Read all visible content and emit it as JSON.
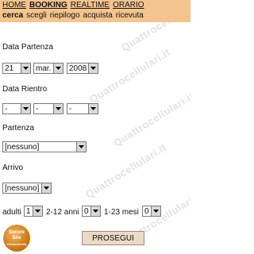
{
  "nav": {
    "links": [
      "HOME",
      "BOOKING",
      "REALTIME",
      "ORARIO"
    ],
    "sublinks": [
      "cerca",
      "scegli",
      "riepilogo",
      "acquista",
      "ricevuta"
    ]
  },
  "form": {
    "data_partenza_label": "Data Partenza",
    "partenza_day": "21",
    "partenza_month": "mar.",
    "partenza_year": "2008",
    "data_rientro_label": "Data Rientro",
    "rientro_day": "-",
    "rientro_month": "-",
    "rientro_year": "-",
    "partenza_label": "Partenza",
    "partenza_value": "[nessuno]",
    "arrivo_label": "Arrivo",
    "arrivo_value": "[nessuno]",
    "adulti_label": "adulti",
    "adulti_value": "1",
    "bambini_label": "2-12 anni",
    "bambini_value": "0",
    "infanti_label": "1-23 mesi",
    "infanti_value": "0",
    "submit_label": "PROSEGUI"
  },
  "badge": {
    "line1": "Secure",
    "line2": "Site",
    "line3": "Clickonverify"
  },
  "watermark": "Quattrocellulari.it"
}
